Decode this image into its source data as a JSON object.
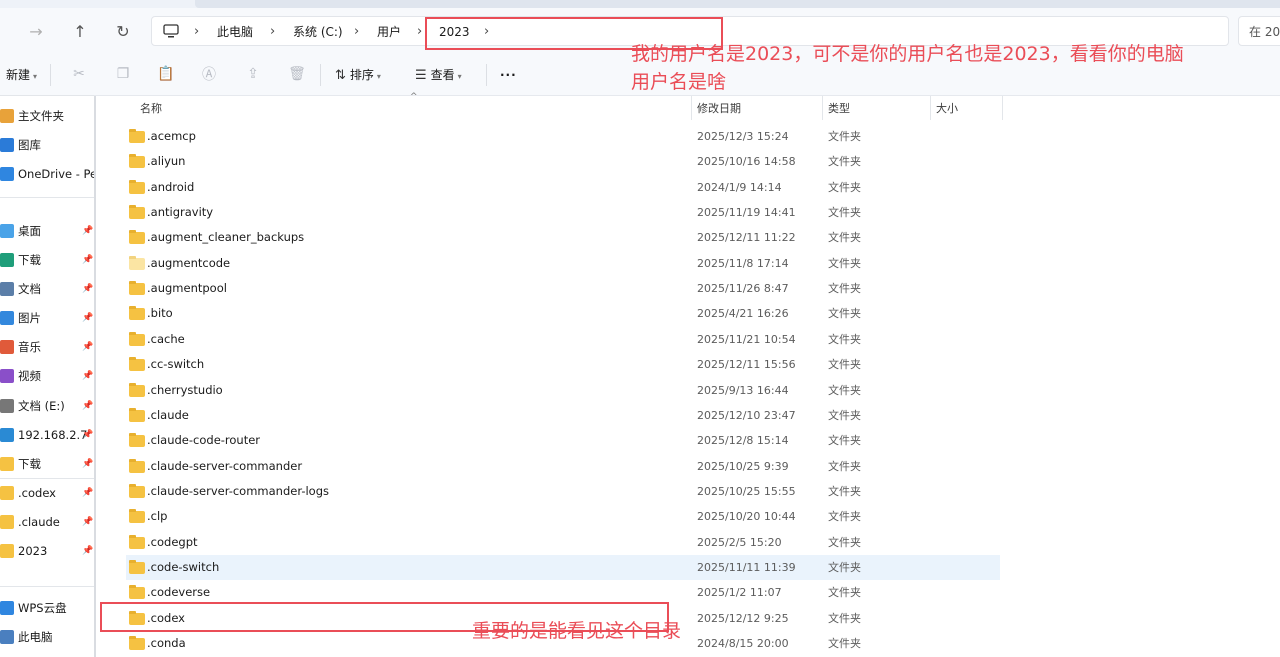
{
  "address": {
    "crumbs": [
      "此电脑",
      "系统 (C:)",
      "用户",
      "2023"
    ],
    "search_placeholder": "在 20"
  },
  "toolbar": {
    "new_label": "新建",
    "sort_label": "排序",
    "view_label": "查看",
    "more_label": "···"
  },
  "sidebar": {
    "items": [
      {
        "label": "主文件夹",
        "color": "#e8a23a",
        "pinned": false
      },
      {
        "label": "图库",
        "color": "#2b7bd8",
        "pinned": false
      },
      {
        "label": "OneDrive - Per",
        "color": "#2f86e0",
        "pinned": false
      },
      {
        "label": "桌面",
        "color": "#4aa3e8",
        "pinned": true
      },
      {
        "label": "下载",
        "color": "#1f9e7a",
        "pinned": true
      },
      {
        "label": "文档",
        "color": "#5b7ea8",
        "pinned": true
      },
      {
        "label": "图片",
        "color": "#3388dd",
        "pinned": true
      },
      {
        "label": "音乐",
        "color": "#e05a3a",
        "pinned": true
      },
      {
        "label": "视频",
        "color": "#8a4fc9",
        "pinned": true
      },
      {
        "label": "文档 (E:)",
        "color": "#777777",
        "pinned": true
      },
      {
        "label": "192.168.2.7",
        "color": "#2a8ad4",
        "pinned": true
      },
      {
        "label": "下载",
        "color": "#f5c242",
        "pinned": true
      },
      {
        "label": ".codex",
        "color": "#f5c242",
        "pinned": true
      },
      {
        "label": ".claude",
        "color": "#f5c242",
        "pinned": true
      },
      {
        "label": "2023",
        "color": "#f5c242",
        "pinned": true
      },
      {
        "label": "WPS云盘",
        "color": "#2f86e0",
        "pinned": false
      },
      {
        "label": "此电脑",
        "color": "#4a7fbf",
        "pinned": false
      }
    ],
    "pin_glyph": "📌"
  },
  "columns": {
    "name": "名称",
    "date": "修改日期",
    "type": "类型",
    "size": "大小"
  },
  "files": [
    {
      "name": ".acemcp",
      "date": "2025/12/3 15:24",
      "type": "文件夹"
    },
    {
      "name": ".aliyun",
      "date": "2025/10/16 14:58",
      "type": "文件夹"
    },
    {
      "name": ".android",
      "date": "2024/1/9 14:14",
      "type": "文件夹"
    },
    {
      "name": ".antigravity",
      "date": "2025/11/19 14:41",
      "type": "文件夹"
    },
    {
      "name": ".augment_cleaner_backups",
      "date": "2025/12/11 11:22",
      "type": "文件夹"
    },
    {
      "name": ".augmentcode",
      "date": "2025/11/8 17:14",
      "type": "文件夹",
      "light": true
    },
    {
      "name": ".augmentpool",
      "date": "2025/11/26 8:47",
      "type": "文件夹"
    },
    {
      "name": ".bito",
      "date": "2025/4/21 16:26",
      "type": "文件夹"
    },
    {
      "name": ".cache",
      "date": "2025/11/21 10:54",
      "type": "文件夹"
    },
    {
      "name": ".cc-switch",
      "date": "2025/12/11 15:56",
      "type": "文件夹"
    },
    {
      "name": ".cherrystudio",
      "date": "2025/9/13 16:44",
      "type": "文件夹"
    },
    {
      "name": ".claude",
      "date": "2025/12/10 23:47",
      "type": "文件夹"
    },
    {
      "name": ".claude-code-router",
      "date": "2025/12/8 15:14",
      "type": "文件夹"
    },
    {
      "name": ".claude-server-commander",
      "date": "2025/10/25 9:39",
      "type": "文件夹"
    },
    {
      "name": ".claude-server-commander-logs",
      "date": "2025/10/25 15:55",
      "type": "文件夹"
    },
    {
      "name": ".clp",
      "date": "2025/10/20 10:44",
      "type": "文件夹"
    },
    {
      "name": ".codegpt",
      "date": "2025/2/5 15:20",
      "type": "文件夹"
    },
    {
      "name": ".code-switch",
      "date": "2025/11/11 11:39",
      "type": "文件夹",
      "hover": true
    },
    {
      "name": ".codeverse",
      "date": "2025/1/2 11:07",
      "type": "文件夹"
    },
    {
      "name": ".codex",
      "date": "2025/12/12 9:25",
      "type": "文件夹"
    },
    {
      "name": ".conda",
      "date": "2024/8/15 20:00",
      "type": "文件夹"
    }
  ],
  "annotations": {
    "username_note_line1": "我的用户名是2023，可不是你的用户名也是2023，看看你的电脑",
    "username_note_line2": "用户名是啥",
    "codex_note": "重要的是能看见这个目录",
    "color": "#ea4d57"
  }
}
